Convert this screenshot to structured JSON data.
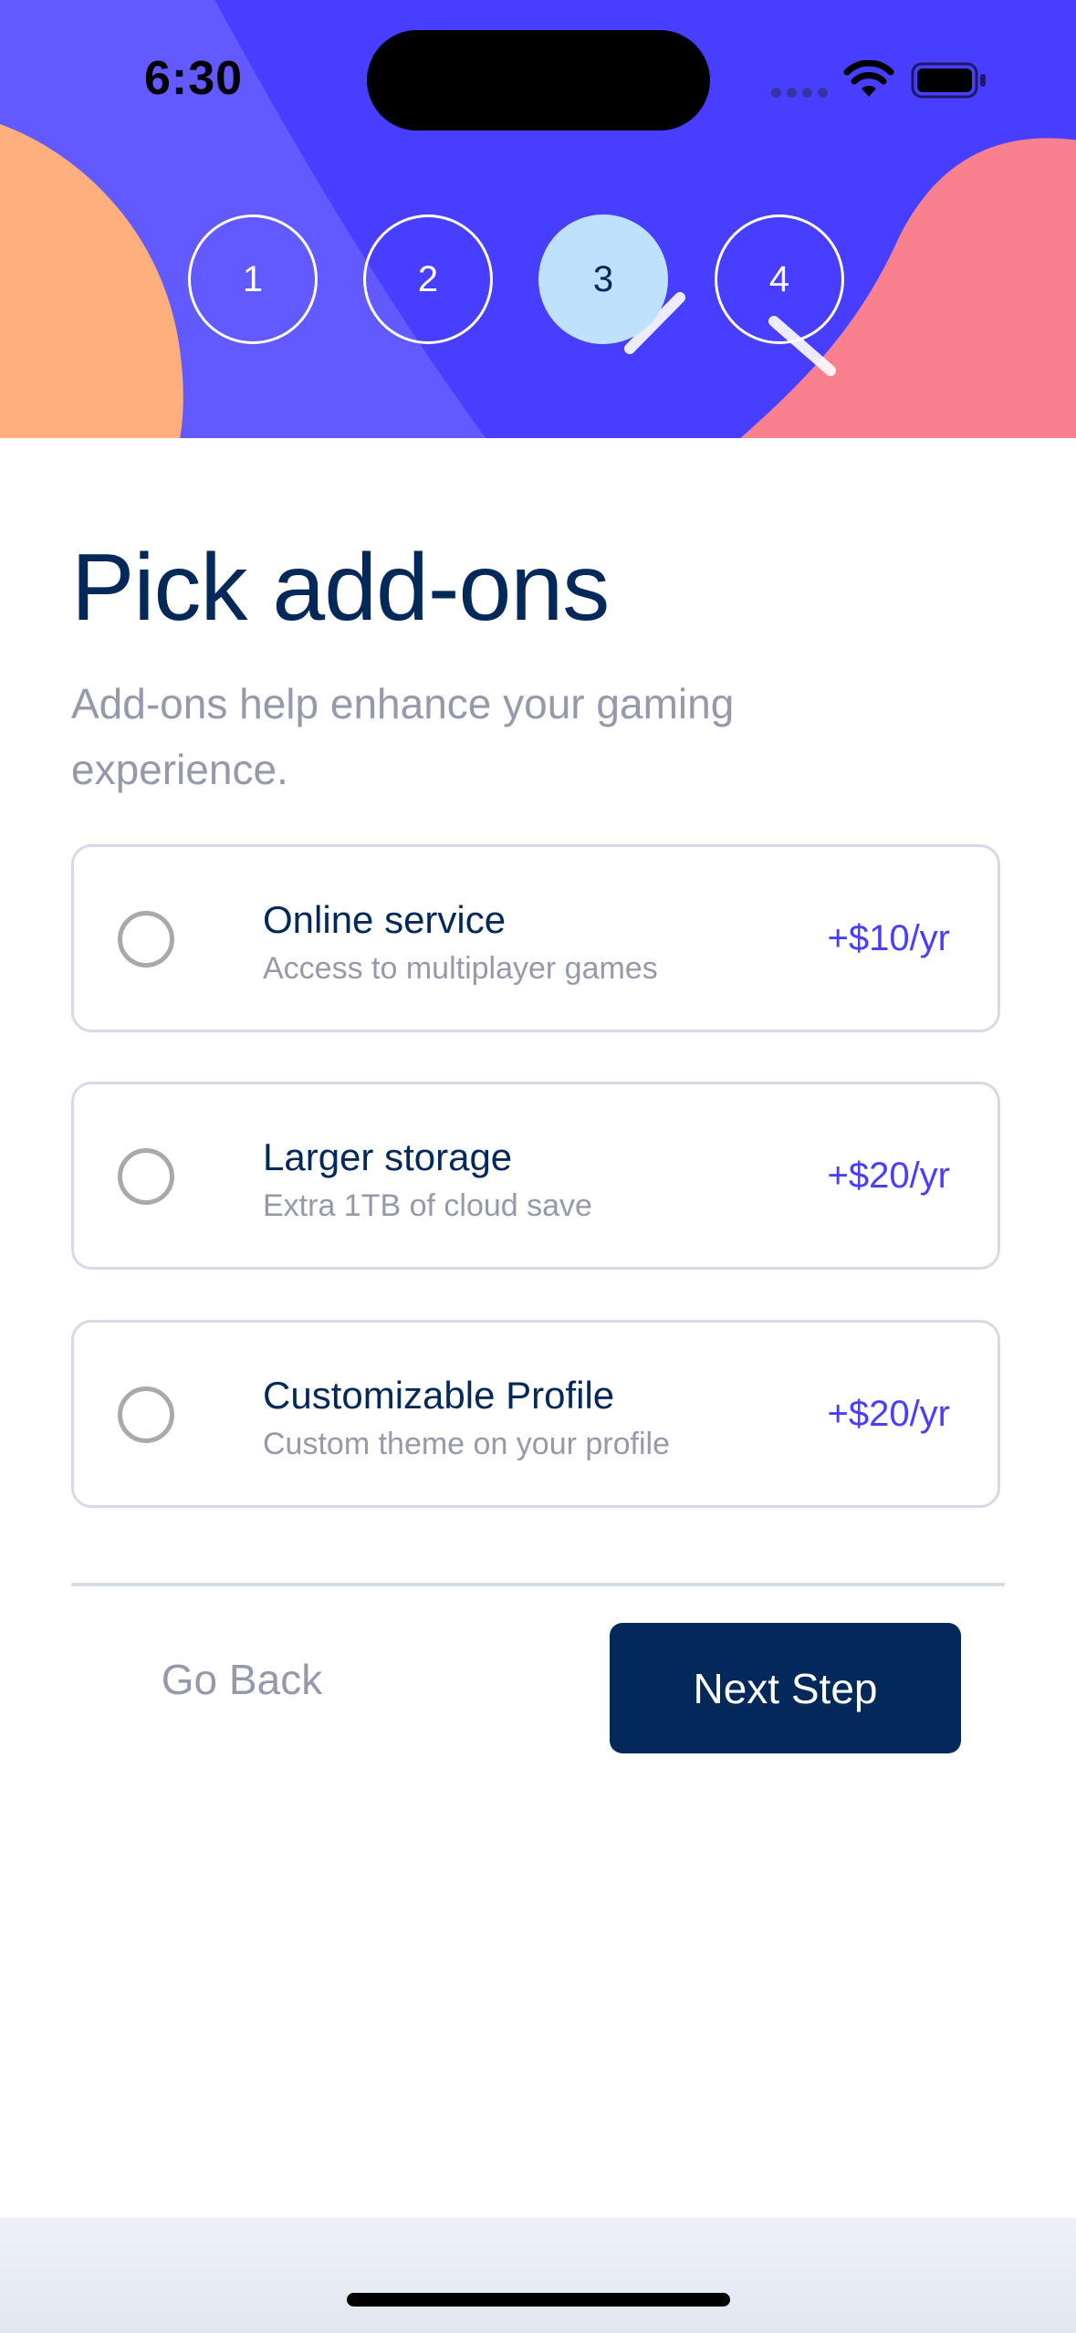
{
  "status_bar": {
    "time": "6:30"
  },
  "steps": [
    {
      "label": "1",
      "active": false
    },
    {
      "label": "2",
      "active": false
    },
    {
      "label": "3",
      "active": true
    },
    {
      "label": "4",
      "active": false
    }
  ],
  "page": {
    "title": "Pick add-ons",
    "subtitle": "Add-ons help enhance your gaming experience."
  },
  "addons": [
    {
      "name": "Online service",
      "description": "Access to multiplayer games",
      "price": "+$10/yr",
      "selected": false
    },
    {
      "name": "Larger storage",
      "description": "Extra 1TB of cloud save",
      "price": "+$20/yr",
      "selected": false
    },
    {
      "name": "Customizable Profile",
      "description": "Custom theme on your profile",
      "price": "+$20/yr",
      "selected": false
    }
  ],
  "footer": {
    "back_label": "Go Back",
    "next_label": "Next Step"
  },
  "colors": {
    "hero_purple": "#483eff",
    "marine_blue": "#02295a",
    "light_blue": "#bee2fd",
    "cool_gray": "#9699ab",
    "border": "#d6d9e6",
    "orange_blob": "#ffaf7e",
    "pink_blob": "#f9818e"
  }
}
